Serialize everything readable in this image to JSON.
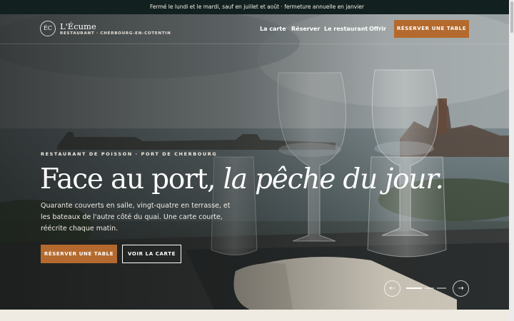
{
  "announcement": "Fermé le lundi et le mardi, sauf en juillet et août · fermeture annuelle en janvier",
  "brand": {
    "mark": "ÉC",
    "name": "L'Écume",
    "tagline": "RESTAURANT · CHERBOURG-EN-COTENTIN"
  },
  "nav": {
    "links": [
      "La carte",
      "Réserver",
      "Le restaurant",
      "Offrir"
    ],
    "cta": "RÉSERVER UNE TABLE"
  },
  "hero": {
    "kicker": "RESTAURANT DE POISSON · PORT DE CHERBOURG",
    "headline_regular": "Face au port, ",
    "headline_italic": "la pêche du jour.",
    "lede": "Quarante couverts en salle, vingt-quatre en terrasse, et les bateaux de l'autre côté du quai. Une carte courte, réécrite chaque matin.",
    "primary_button": "RÉSERVER UNE TABLE",
    "secondary_button": "VOIR LA CARTE"
  },
  "carousel": {
    "prev_icon": "arrow-left-icon",
    "next_icon": "arrow-right-icon",
    "prev_glyph": "←",
    "next_glyph": "→",
    "slide_count": 3,
    "active_slide": 1
  },
  "colors": {
    "accent": "#b46a2e",
    "announcement_bg": "#12211f",
    "page_bg": "#f0ebe2"
  }
}
